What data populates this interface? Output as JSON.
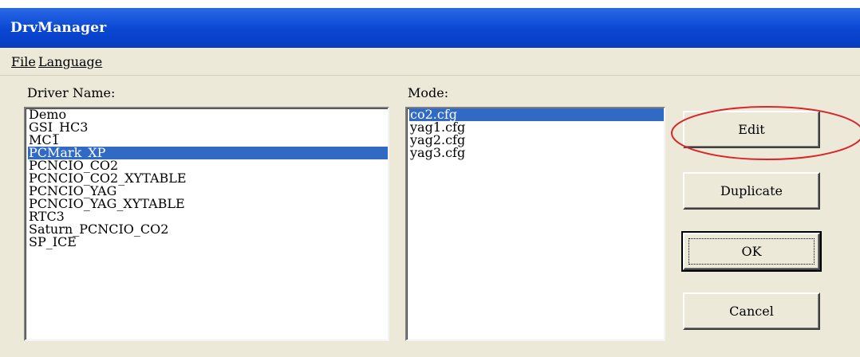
{
  "window": {
    "title": "DrvManager"
  },
  "menu": {
    "file_label": "File",
    "language_label": "Language"
  },
  "driver_list": {
    "label": "Driver Name:",
    "items": [
      "Demo",
      "GSI_HC3",
      "MC1",
      "PCMark_XP",
      "PCNCIO_CO2",
      "PCNCIO_CO2_XYTABLE",
      "PCNCIO_YAG",
      "PCNCIO_YAG_XYTABLE",
      "RTC3",
      "Saturn_PCNCIO_CO2",
      "SP_ICE"
    ],
    "selected_index": 3
  },
  "mode_list": {
    "label": "Mode:",
    "items": [
      "co2.cfg",
      "yag1.cfg",
      "yag2.cfg",
      "yag3.cfg"
    ],
    "selected_index": 0
  },
  "buttons": {
    "edit": "Edit",
    "duplicate": "Duplicate",
    "ok": "OK",
    "cancel": "Cancel"
  },
  "colors": {
    "title_bar": "#0a46d2",
    "selection": "#316ac5",
    "annotation_ellipse": "#d9262b",
    "window_bg": "#ece9d8"
  }
}
